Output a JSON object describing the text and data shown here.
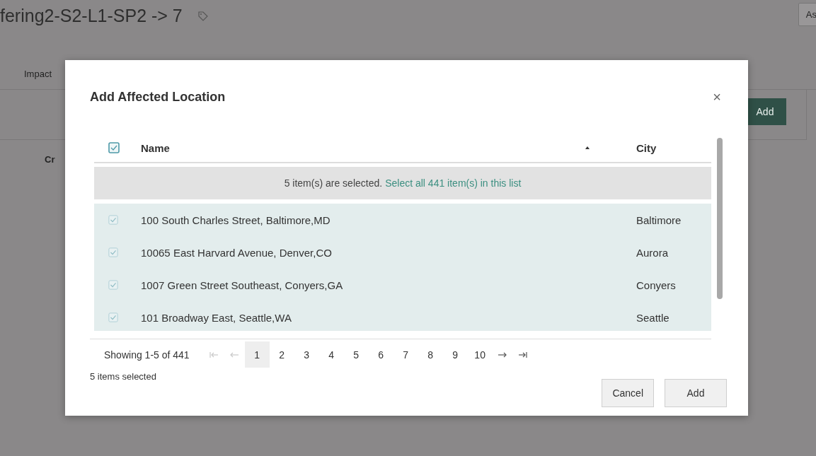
{
  "page": {
    "title": "fering2-S2-L1-SP2 -> 7",
    "top_button": "As",
    "tab": "Impact",
    "add_button": "Add",
    "column": "Cr"
  },
  "dialog": {
    "title": "Add Affected Location",
    "close": "×",
    "table": {
      "all_checked": true,
      "columns": [
        {
          "label": "Name",
          "sorted": true
        },
        {
          "label": "City",
          "sorted": false
        }
      ],
      "banner": {
        "text": "5 item(s) are selected.",
        "link": "Select all 441 item(s) in this list"
      },
      "rows": [
        {
          "name": "100 South Charles Street, Baltimore,MD",
          "city": "Baltimore",
          "checked": true
        },
        {
          "name": "10065 East Harvard Avenue, Denver,CO",
          "city": "Aurora",
          "checked": true
        },
        {
          "name": "1007 Green Street Southeast, Conyers,GA",
          "city": "Conyers",
          "checked": true
        },
        {
          "name": "101 Broadway East, Seattle,WA",
          "city": "Seattle",
          "checked": true
        }
      ]
    },
    "pagination": {
      "summary": "Showing 1-5 of 441",
      "nav": [
        {
          "kind": "first",
          "disabled": true
        },
        {
          "kind": "prev",
          "disabled": true
        }
      ],
      "pages": [
        {
          "label": "1",
          "selected": true
        },
        {
          "label": "2",
          "selected": false
        },
        {
          "label": "3",
          "selected": false
        },
        {
          "label": "4",
          "selected": false
        },
        {
          "label": "5",
          "selected": false
        },
        {
          "label": "6",
          "selected": false
        },
        {
          "label": "7",
          "selected": false
        },
        {
          "label": "8",
          "selected": false
        },
        {
          "label": "9",
          "selected": false
        },
        {
          "label": "10",
          "selected": false
        }
      ],
      "nav_after": [
        {
          "kind": "next",
          "disabled": false
        },
        {
          "kind": "last",
          "disabled": false
        }
      ]
    },
    "selection_note": "5 items selected",
    "buttons": [
      "Cancel",
      "Add"
    ]
  }
}
